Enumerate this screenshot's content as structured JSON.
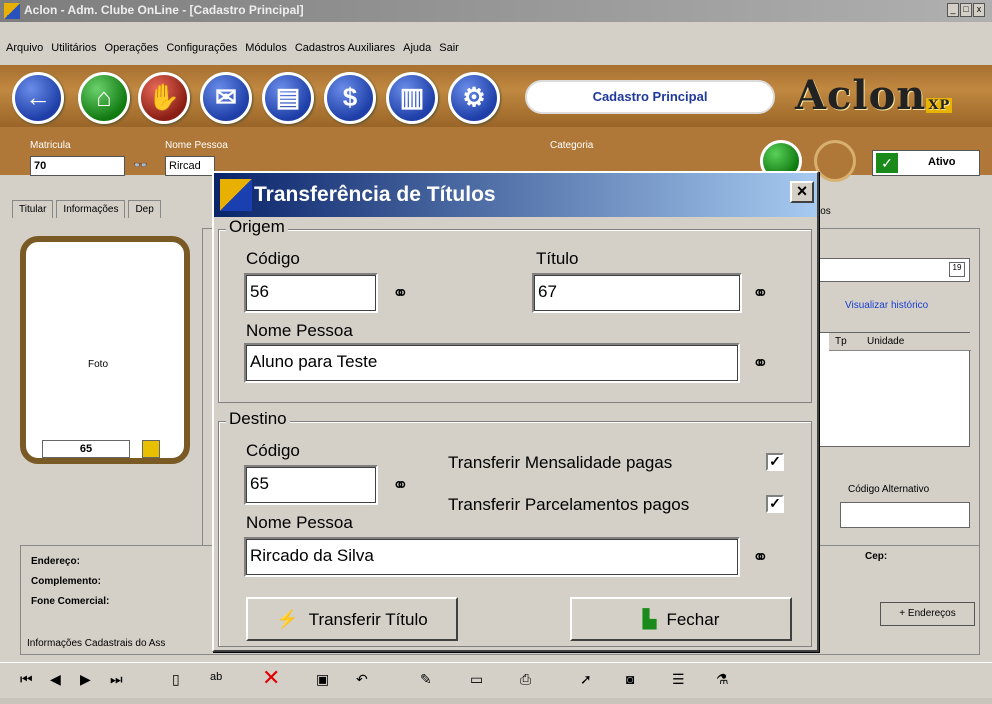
{
  "window": {
    "title": "Aclon - Adm. Clube OnLine - [Cadastro Principal]",
    "buttons": [
      "_",
      "□",
      "x"
    ]
  },
  "menu": [
    "Arquivo",
    "Utilitários",
    "Operações",
    "Configurações",
    "Módulos",
    "Cadastros Auxiliares",
    "Ajuda",
    "Sair"
  ],
  "toolbar": {
    "section_title": "Cadastro Principal",
    "brand": "Aclon",
    "brand_suffix": "XP"
  },
  "header": {
    "matricula_label": "Matricula",
    "matricula_value": "70",
    "nome_label": "Nome Pessoa",
    "nome_value": "Rircad",
    "categoria_label": "Categoria",
    "status": "Ativo"
  },
  "tabs": [
    "Titular",
    "Informações",
    "Dep"
  ],
  "tabs_right": "ios",
  "photo": {
    "label": "Foto",
    "number": "65"
  },
  "right_panel": {
    "history_link": "Visualizar histórico",
    "grid_cols": [
      "Tp",
      "Unidade"
    ],
    "codigo_alt_label": "Código Alternativo"
  },
  "address": {
    "rows": [
      "Endereço:",
      "Complemento:",
      "Fone Comercial:"
    ],
    "footer": "Informações Cadastrais do Ass",
    "cep_label": "Cep:",
    "more_button": "+ Endereços"
  },
  "dialog": {
    "title": "Transferência de Títulos",
    "close": "×",
    "origem": {
      "title": "Origem",
      "codigo_label": "Código",
      "codigo_value": "56",
      "titulo_label": "Título",
      "titulo_value": "67",
      "nome_label": "Nome Pessoa",
      "nome_value": "Aluno para Teste"
    },
    "destino": {
      "title": "Destino",
      "codigo_label": "Código",
      "codigo_value": "65",
      "mens_label": "Transferir Mensalidade pagas",
      "mens_checked": true,
      "parc_label": "Transferir Parcelamentos pagos",
      "parc_checked": true,
      "nome_label": "Nome Pessoa",
      "nome_value": "Rircado da Silva"
    },
    "transfer_button": "Transferir Título",
    "close_button": "Fechar"
  }
}
